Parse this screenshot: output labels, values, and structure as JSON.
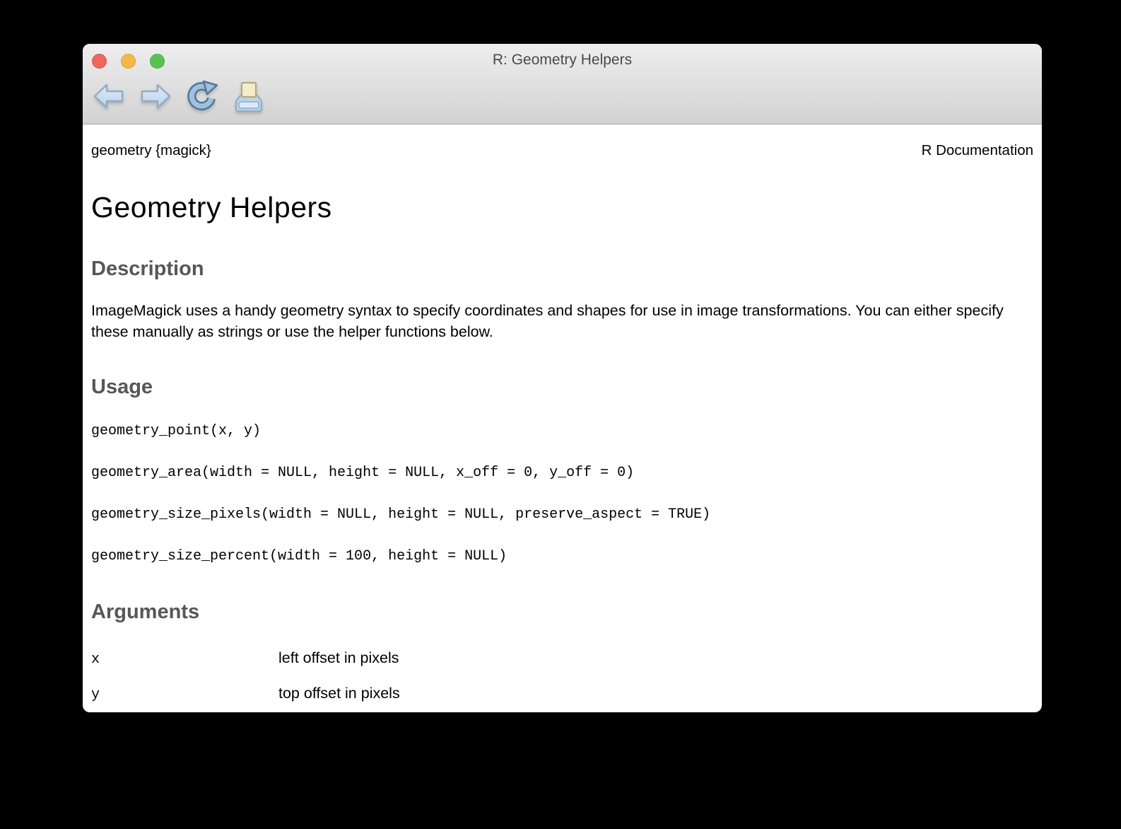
{
  "window": {
    "title": "R: Geometry Helpers",
    "traffic_lights": [
      "close",
      "minimize",
      "zoom"
    ]
  },
  "toolbar": {
    "icons": [
      "back-icon",
      "forward-icon",
      "refresh-icon",
      "print-icon"
    ]
  },
  "page": {
    "package_ref": "geometry {magick}",
    "doc_label": "R Documentation",
    "title": "Geometry Helpers",
    "sections": {
      "description": {
        "heading": "Description",
        "text": "ImageMagick uses a handy geometry syntax to specify coordinates and shapes for use in image transformations. You can either specify these manually as strings or use the helper functions below."
      },
      "usage": {
        "heading": "Usage",
        "code": "geometry_point(x, y)\n\ngeometry_area(width = NULL, height = NULL, x_off = 0, y_off = 0)\n\ngeometry_size_pixels(width = NULL, height = NULL, preserve_aspect = TRUE)\n\ngeometry_size_percent(width = 100, height = NULL)"
      },
      "arguments": {
        "heading": "Arguments",
        "items": [
          {
            "name": "x",
            "description": "left offset in pixels"
          },
          {
            "name": "y",
            "description": "top offset in pixels"
          }
        ]
      }
    }
  },
  "colors": {
    "desktop_background": "#000000",
    "titlebar_top": "#eeeeee",
    "titlebar_bottom": "#d2d2d2",
    "titlebar_border": "#a6a6a6",
    "traffic_red": "#ec685e",
    "traffic_yellow": "#f3b846",
    "traffic_green": "#57c353",
    "icon_blue_fill": "#cfe0ef",
    "icon_blue_border": "#8fadc9",
    "refresh_blue": "#6b92bc",
    "paper_cream": "#f6ecca",
    "section_heading_gray": "#575757"
  }
}
